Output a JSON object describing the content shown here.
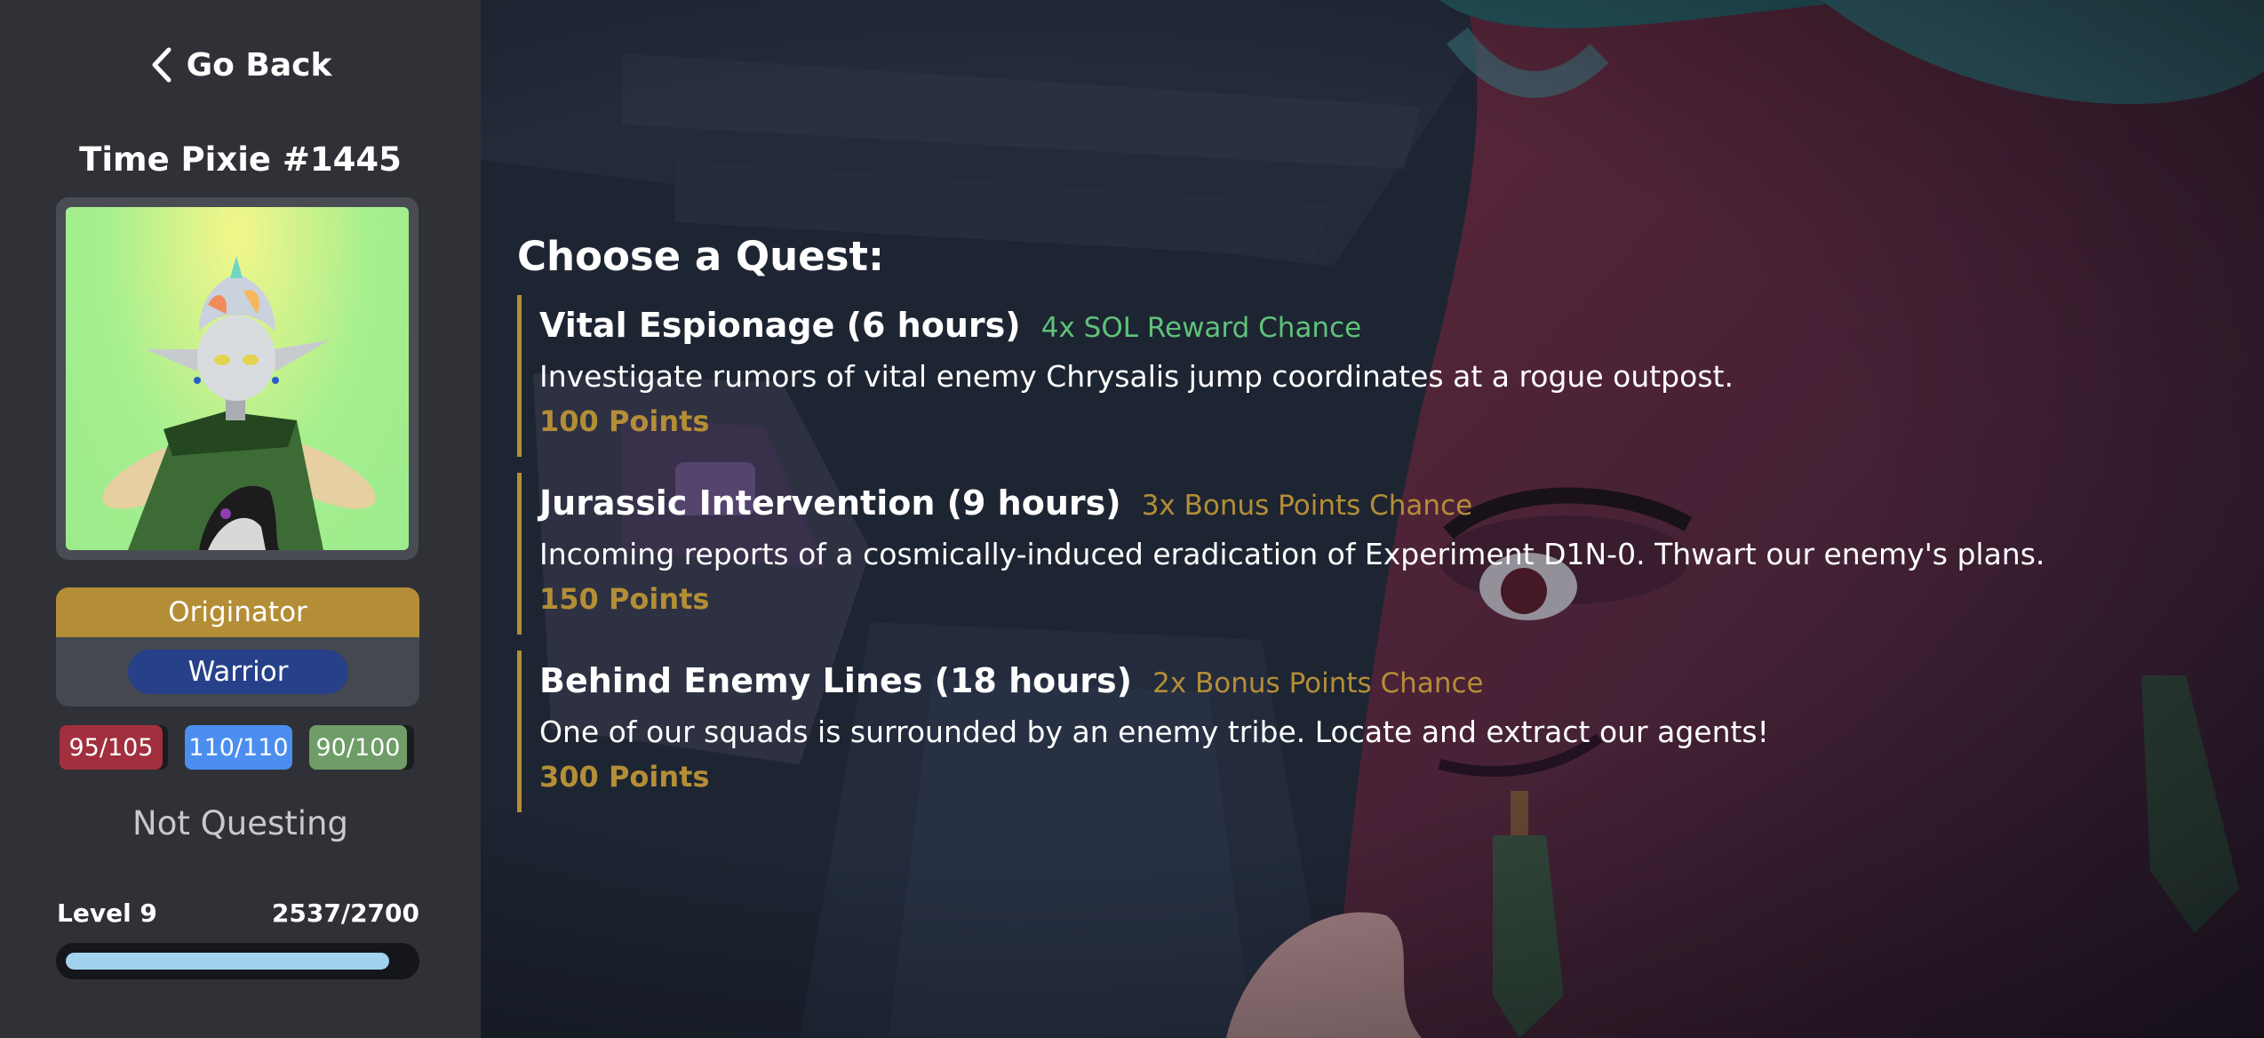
{
  "sidebar": {
    "go_back_label": "Go Back",
    "nft_name": "Time Pixie #1445",
    "rank": "Originator",
    "class": "Warrior",
    "stats": [
      {
        "value": "95/105",
        "color": "#a22f3d"
      },
      {
        "value": "110/110",
        "color": "#4c8ef0"
      },
      {
        "value": "90/100",
        "color": "#6e9d67"
      }
    ],
    "status": "Not Questing",
    "level_label": "Level 9",
    "xp_label": "2537/2700",
    "xp_progress": 0.94
  },
  "main": {
    "heading": "Choose a Quest:",
    "quests": [
      {
        "title": "Vital Espionage (6 hours)",
        "bonus": "4x SOL Reward Chance",
        "bonus_color": "#5fc27a",
        "description": "Investigate rumors of vital enemy Chrysalis jump coordinates at a rogue outpost.",
        "points": "100 Points"
      },
      {
        "title": "Jurassic Intervention (9 hours)",
        "bonus": "3x Bonus Points Chance",
        "bonus_color": "#b48e36",
        "description": "Incoming reports of a cosmically-induced eradication of Experiment D1N-0. Thwart our enemy's plans.",
        "points": "150 Points"
      },
      {
        "title": "Behind Enemy Lines (18 hours)",
        "bonus": "2x Bonus Points Chance",
        "bonus_color": "#b48e36",
        "description": "One of our squads is surrounded by an enemy tribe. Locate and extract our agents!",
        "points": "300 Points"
      }
    ]
  },
  "colors": {
    "accent_gold": "#b48e36",
    "sidebar_bg": "#2f3137"
  }
}
